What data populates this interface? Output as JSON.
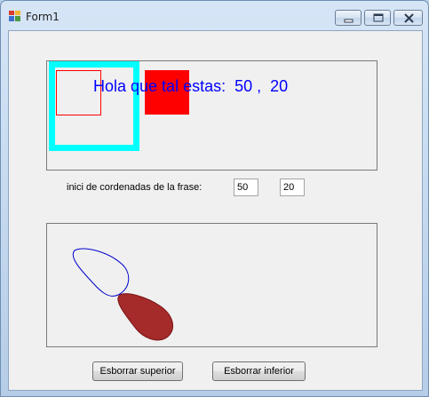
{
  "window": {
    "title": "Form1"
  },
  "top_panel": {
    "phrase": "Hola que tal estas:  50 ,  20"
  },
  "coordinates": {
    "label": "inici de cordenadas de la frase:",
    "x_value": "50",
    "y_value": "20"
  },
  "buttons": {
    "clear_top": "Esborrar superior",
    "clear_bottom": "Esborrar inferior"
  },
  "colors": {
    "cyan": "#00ffff",
    "red": "#ff0000",
    "text_blue": "#0000ff",
    "outline_shape": "#0000cc",
    "filled_shape": "#a52a2a"
  }
}
